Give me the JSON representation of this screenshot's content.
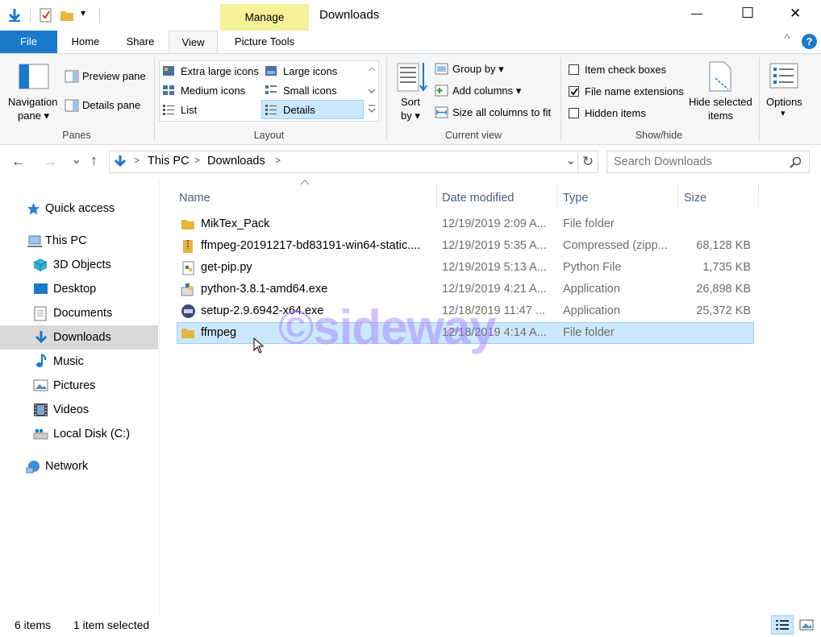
{
  "window": {
    "title": "Downloads",
    "context_tab": "Manage",
    "minimize_glyph": "—",
    "maximize_glyph": "☐",
    "close_glyph": "✕",
    "qat_dropdown_glyph": "▾"
  },
  "ribbon_tabs": {
    "file": "File",
    "home": "Home",
    "share": "Share",
    "view": "View",
    "picture_tools": "Picture Tools",
    "collapse_glyph": "^",
    "help_glyph": "?"
  },
  "ribbon": {
    "panes": {
      "navigation_pane_l1": "Navigation",
      "navigation_pane_l2": "pane ▾",
      "preview_pane": "Preview pane",
      "details_pane": "Details pane",
      "label": "Panes"
    },
    "layout": {
      "extra_large_icons": "Extra large icons",
      "large_icons": "Large icons",
      "medium_icons": "Medium icons",
      "small_icons": "Small icons",
      "list": "List",
      "details": "Details",
      "label": "Layout"
    },
    "current_view": {
      "sort_by_l1": "Sort",
      "sort_by_l2": "by ▾",
      "group_by": "Group by ▾",
      "add_columns": "Add columns ▾",
      "size_all_columns": "Size all columns to fit",
      "label": "Current view"
    },
    "show_hide": {
      "item_check_boxes": "Item check boxes",
      "item_check_boxes_checked": false,
      "file_name_extensions": "File name extensions",
      "file_name_extensions_checked": true,
      "hidden_items": "Hidden items",
      "hidden_items_checked": false,
      "hide_selected_l1": "Hide selected",
      "hide_selected_l2": "items",
      "label": "Show/hide"
    },
    "options": {
      "label": "Options",
      "dropdown": "▾"
    }
  },
  "address": {
    "back": "←",
    "forward": "→",
    "recent": "⌄",
    "up": "↑",
    "crumbs": [
      "This PC",
      "Downloads"
    ],
    "crumb_sep": ">",
    "dropdown": "⌄",
    "refresh": "↻",
    "search_placeholder": "Search Downloads"
  },
  "nav": {
    "quick_access": "Quick access",
    "this_pc": "This PC",
    "objects_3d": "3D Objects",
    "desktop": "Desktop",
    "documents": "Documents",
    "downloads": "Downloads",
    "music": "Music",
    "pictures": "Pictures",
    "videos": "Videos",
    "local_disk": "Local Disk (C:)",
    "network": "Network"
  },
  "columns": {
    "name": "Name",
    "date_modified": "Date modified",
    "type": "Type",
    "size": "Size"
  },
  "files": [
    {
      "name": "MikTex_Pack",
      "date": "12/19/2019 2:09 A...",
      "type": "File folder",
      "size": "",
      "icon": "folder-icon"
    },
    {
      "name": "ffmpeg-20191217-bd83191-win64-static....",
      "date": "12/19/2019 5:35 A...",
      "type": "Compressed (zipp...",
      "size": "68,128 KB",
      "icon": "zip-icon"
    },
    {
      "name": "get-pip.py",
      "date": "12/19/2019 5:13 A...",
      "type": "Python File",
      "size": "1,735 KB",
      "icon": "python-file-icon"
    },
    {
      "name": "python-3.8.1-amd64.exe",
      "date": "12/19/2019 4:21 A...",
      "type": "Application",
      "size": "26,898 KB",
      "icon": "installer-icon"
    },
    {
      "name": "setup-2.9.6942-x64.exe",
      "date": "12/18/2019 11:47 ...",
      "type": "Application",
      "size": "25,372 KB",
      "icon": "miktex-icon"
    },
    {
      "name": "ffmpeg",
      "date": "12/18/2019 4:14 A...",
      "type": "File folder",
      "size": "",
      "icon": "folder-icon",
      "selected": true
    }
  ],
  "status": {
    "item_count": "6 items",
    "selection": "1 item selected"
  },
  "watermark": "©sideway",
  "colors": {
    "accent": "#1979ca",
    "manage_tab": "#f5f29a",
    "selection_bg": "#cce8ff",
    "selection_border": "#99d1ff",
    "folder": "#e8b441",
    "header_text": "#4c607a"
  }
}
